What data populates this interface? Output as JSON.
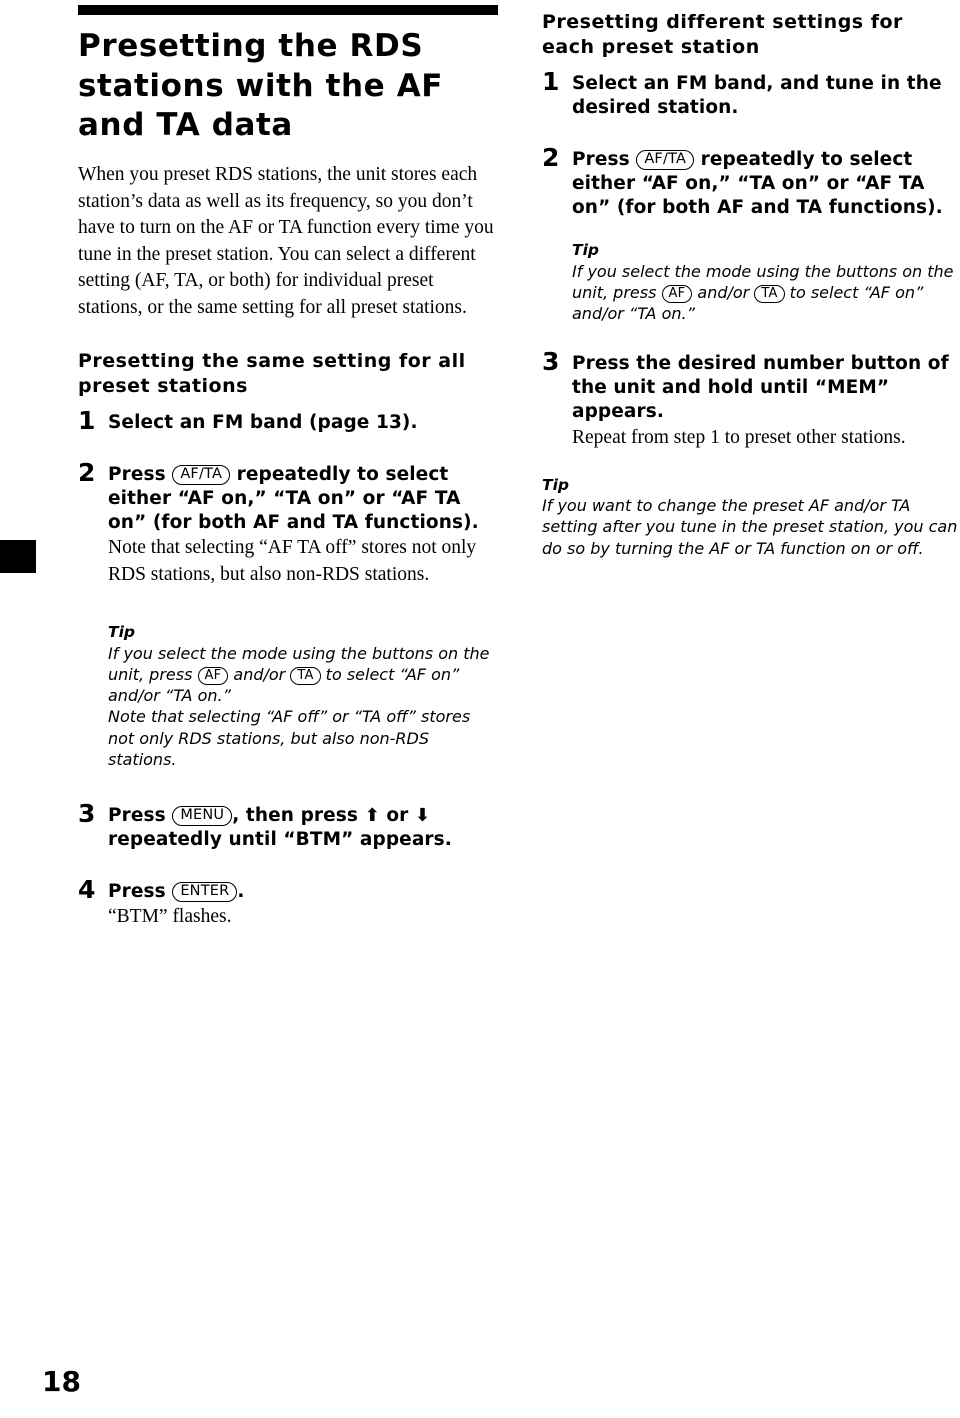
{
  "page": {
    "folio": "18"
  },
  "left_column": {
    "chapter_title": "Presetting the RDS stations with the AF and TA data",
    "intro_paragraph": "When you preset RDS stations, the unit stores each station’s data as well as its frequency, so you don’t have to turn on the AF or TA function every time you tune in the preset station. You can select a different setting (AF, TA, or both) for individual preset stations, or the same setting for all preset stations.",
    "section_title": "Presetting the same setting for all preset stations",
    "steps": [
      {
        "number": "1",
        "head_parts": [
          "Select an FM band (page 13)."
        ]
      },
      {
        "number": "2",
        "head_before_key": "Press",
        "key": "AF/TA",
        "head_after_key": "repeatedly to select either “AF on,” “TA on” or “AF TA on” (for both AF and TA functions).",
        "sub": "Note that selecting “AF TA off” stores not only RDS stations, but also non-RDS stations."
      },
      {
        "number": "3",
        "head_before_key": "Press",
        "key": "MENU",
        "head_mid": ", then press",
        "arrow_up": "⬆",
        "head_or": "or",
        "arrow_down": "⬇",
        "head_after": "repeatedly until “BTM” appears."
      },
      {
        "number": "4",
        "head_before_key": "Press",
        "key": "ENTER",
        "head_after_key": ".",
        "sub": "“BTM” flashes."
      }
    ],
    "tip": {
      "label": "Tip",
      "line1_before_af": "If you select the mode using the buttons on the unit, press",
      "key_af": "AF",
      "line1_mid": "and/or",
      "key_ta": "TA",
      "line1_after": "to select “AF on” and/or “TA on.”",
      "line2": "Note that selecting “AF off” or “TA off” stores not only RDS stations, but also non-RDS stations."
    }
  },
  "right_column": {
    "section_title": "Presetting different settings for each preset station",
    "steps": [
      {
        "number": "1",
        "head": "Select an FM band, and tune in the desired station."
      },
      {
        "number": "2",
        "head_before_key": "Press",
        "key": "AF/TA",
        "head_after_key": "repeatedly to select either “AF on,” “TA on” or “AF TA on” (for both AF and TA functions)."
      },
      {
        "number": "3",
        "head": "Press the desired number button of the unit and hold until “MEM” appears.",
        "sub": "Repeat from step 1 to preset other stations."
      }
    ],
    "tip_1": {
      "label": "Tip",
      "line_before_af": "If you select the mode using the buttons on the unit, press",
      "key_af": "AF",
      "line_mid": "and/or",
      "key_ta": "TA",
      "line_after": "to select “AF on” and/or “TA on.”"
    },
    "tip_2": {
      "label": "Tip",
      "text": "If you want to change the preset AF and/or TA setting after you tune in the preset station, you can do so by turning the AF or TA function on or off."
    }
  }
}
